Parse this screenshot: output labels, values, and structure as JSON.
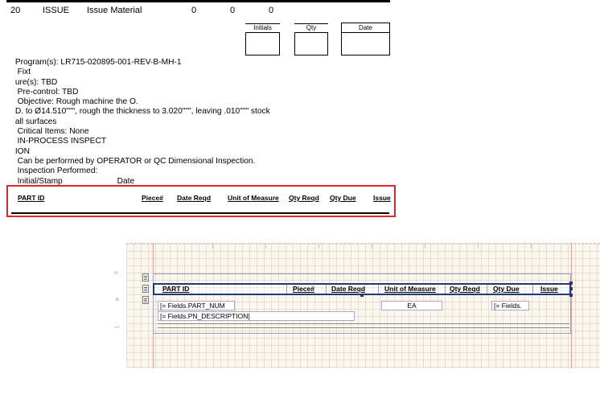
{
  "report": {
    "operation": {
      "number": "20",
      "code": "ISSUE",
      "description": "Issue Material",
      "val1": "0",
      "val2": "0",
      "val3": "0"
    },
    "signoff": {
      "initials_label": "Initials",
      "qty_label": "Qty",
      "date_label": "Date"
    },
    "notes": [
      " Program(s): LR715-020895-001-REV-B-MH-1",
      "  Fixt",
      " ure(s): TBD",
      "  Pre-control: TBD",
      "  Objective: Rough machine the O.",
      " D. to Ø14.510\"\"\", rough the thickness to 3.020\"\"\", leaving .010\"\"\" stock",
      " all surfaces",
      "  Critical Items: None",
      "  IN-PROCESS INSPECT",
      " ION",
      "  Can be performed by OPERATOR or QC Dimensional Inspection.",
      "  Inspection Performed:",
      "  Initial/Stamp                        Date"
    ],
    "table_headers": [
      "PART ID",
      "Piece#",
      "Date Reqd",
      "Unit of Measure",
      "Qty Reqd",
      "Qty Due",
      "Issue"
    ]
  },
  "designer": {
    "ruler_labels": [
      "0",
      "in",
      "1"
    ],
    "table_headers": [
      "PART ID",
      "Piece#",
      "Date Reqd",
      "Unit of Measure",
      "Qty Reqd",
      "Qty Due",
      "Issue"
    ],
    "fields": {
      "part_num": "[= Fields.PART_NUM",
      "uom": "EA",
      "qty_due": "[= Fields.",
      "pn_description": "[= Fields.PN_DESCRIPTION]"
    },
    "colors": {
      "selection": "#1f3a7a",
      "highlight": "#e0242c",
      "grid_bg": "#fbf7ef"
    }
  }
}
